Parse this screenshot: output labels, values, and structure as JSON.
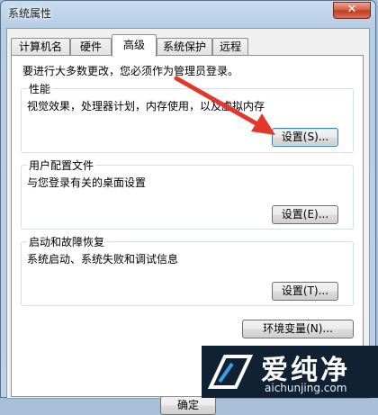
{
  "window": {
    "title": "系统属性",
    "close_label": "✕"
  },
  "tabs": [
    {
      "label": "计算机名"
    },
    {
      "label": "硬件"
    },
    {
      "label": "高级"
    },
    {
      "label": "系统保护"
    },
    {
      "label": "远程"
    }
  ],
  "active_tab": 2,
  "notice": "要进行大多数更改，您必须作为管理员登录。",
  "performance": {
    "title": "性能",
    "description": "视觉效果，处理器计划，内存使用，以及虚拟内存",
    "button": "设置(S)..."
  },
  "user_profiles": {
    "title": "用户配置文件",
    "description": "与您登录有关的桌面设置",
    "button": "设置(E)..."
  },
  "startup_recovery": {
    "title": "启动和故障恢复",
    "description": "系统启动、系统失败和调试信息",
    "button": "设置(T)..."
  },
  "env_button": "环境变量(N)...",
  "ok_button": "确定",
  "watermark": {
    "brand": "爱纯净",
    "url": "aichunjing.com"
  },
  "colors": {
    "arrow": "#e5362b",
    "accent": "#3c7fb1"
  }
}
